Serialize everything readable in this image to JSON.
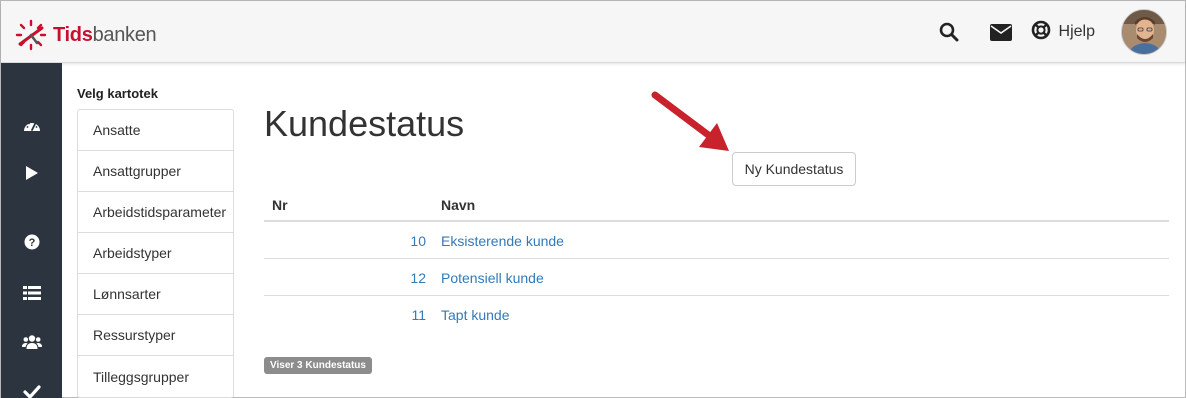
{
  "brand": {
    "name_part1": "Tids",
    "name_part2": "banken",
    "accent": "#c8102e"
  },
  "topbar": {
    "icons": [
      "search-icon",
      "mail-icon",
      "lifebuoy-icon"
    ],
    "help_label": "Hjelp"
  },
  "leftnav": {
    "background": "#2c3440",
    "icons": [
      "dashboard-icon",
      "play-icon",
      "question-icon",
      "list-icon",
      "users-icon",
      "check-icon"
    ]
  },
  "kartotek": {
    "label": "Velg kartotek",
    "items": [
      "Ansatte",
      "Ansattgrupper",
      "Arbeidstidsparameter",
      "Arbeidstyper",
      "Lønnsarter",
      "Ressurstyper",
      "Tilleggsgrupper"
    ]
  },
  "page": {
    "title": "Kundestatus",
    "new_button": "Ny Kundestatus"
  },
  "table": {
    "headers": {
      "nr": "Nr",
      "navn": "Navn"
    },
    "rows": [
      {
        "nr": "10",
        "navn": "Eksisterende kunde"
      },
      {
        "nr": "12",
        "navn": "Potensiell kunde"
      },
      {
        "nr": "11",
        "navn": "Tapt kunde"
      }
    ],
    "link_color": "#337ab7"
  },
  "footer": {
    "count_badge": "Viser 3 Kundestatus"
  }
}
